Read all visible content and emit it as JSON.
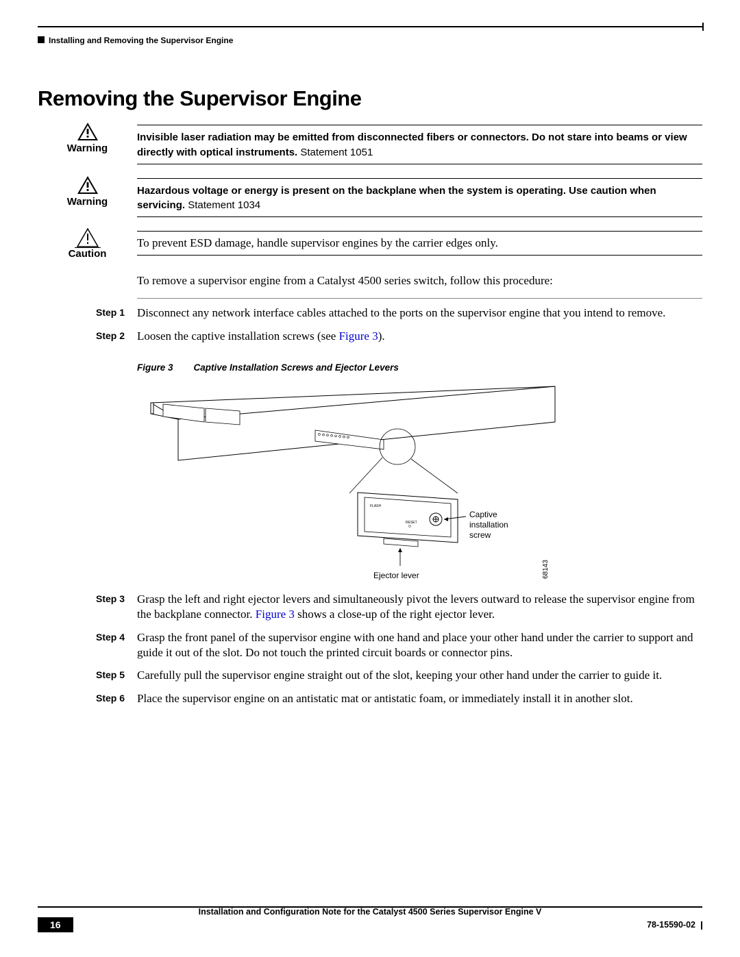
{
  "header": {
    "running_head": "Installing and Removing the Supervisor Engine"
  },
  "section_title": "Removing the Supervisor Engine",
  "warnings": [
    {
      "label": "Warning",
      "bold": "Invisible laser radiation may be emitted from disconnected fibers or connectors. Do not stare into beams or view directly with optical instruments.",
      "plain": " Statement 1051"
    },
    {
      "label": "Warning",
      "bold": "Hazardous voltage or energy is present on the backplane when the system is operating. Use caution when servicing.",
      "plain": " Statement 1034"
    }
  ],
  "caution": {
    "label": "Caution",
    "text": "To prevent ESD damage, handle supervisor engines by the carrier edges only."
  },
  "intro": "To remove a supervisor engine from a Catalyst 4500 series switch, follow this procedure:",
  "steps": [
    {
      "label": "Step 1",
      "text": "Disconnect any network interface cables attached to the ports on the supervisor engine that you intend to remove."
    },
    {
      "label": "Step 2",
      "text_pre": "Loosen the captive installation screws (see ",
      "link": "Figure 3",
      "text_post": ")."
    }
  ],
  "figure": {
    "num": "Figure 3",
    "title": "Captive Installation Screws and Ejector Levers",
    "callout_screw": "Captive\ninstallation\nscrew",
    "callout_lever": "Ejector lever",
    "image_code": "68143"
  },
  "steps_after": [
    {
      "label": "Step 3",
      "text_pre": "Grasp the left and right ejector levers and simultaneously pivot the levers outward to release the supervisor engine from the backplane connector. ",
      "link": "Figure 3",
      "text_post": " shows a close-up of the right ejector lever."
    },
    {
      "label": "Step 4",
      "text": "Grasp the front panel of the supervisor engine with one hand and place your other hand under the carrier to support and guide it out of the slot. Do not touch the printed circuit boards or connector pins."
    },
    {
      "label": "Step 5",
      "text": "Carefully pull the supervisor engine straight out of the slot, keeping your other hand under the carrier to guide it."
    },
    {
      "label": "Step 6",
      "text": "Place the supervisor engine on an antistatic mat or antistatic foam, or immediately install it in another slot."
    }
  ],
  "footer": {
    "doc_title": "Installation and Configuration Note for the Catalyst 4500 Series Supervisor Engine V",
    "page": "16",
    "code": "78-15590-02"
  }
}
